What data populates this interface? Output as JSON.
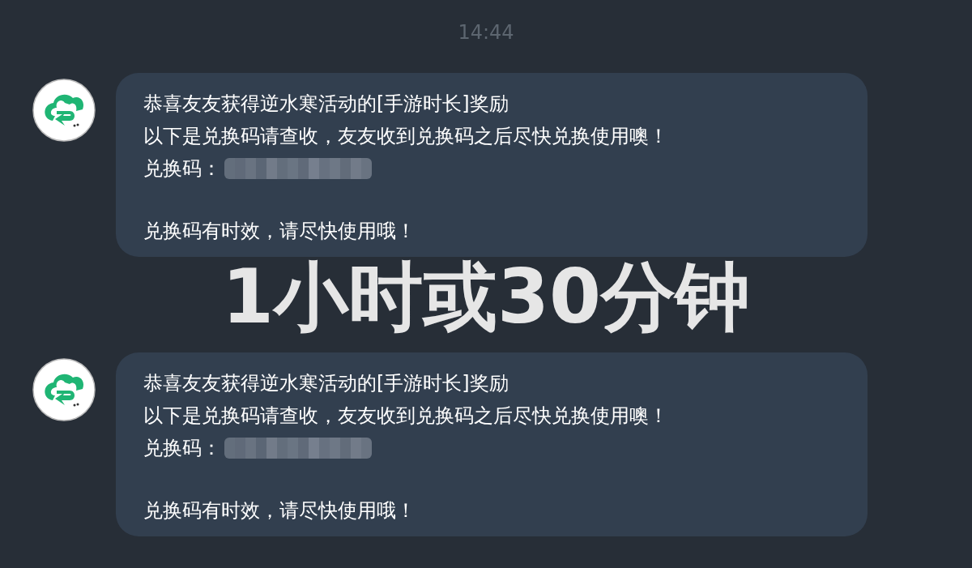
{
  "messages": [
    {
      "time": "14:44",
      "title_line": "恭喜友友获得逆水寒活动的[手游时长]奖励",
      "body_line": "以下是兑换码请查收，友友收到兑换码之后尽快兑换使用噢！",
      "code_label": "兑换码：",
      "note": "兑换码有时效，请尽快使用哦！"
    },
    {
      "title_line": "恭喜友友获得逆水寒活动的[手游时长]奖励",
      "body_line": "以下是兑换码请查收，友友收到兑换码之后尽快兑换使用噢！",
      "code_label": "兑换码：",
      "note": "兑换码有时效，请尽快使用哦！"
    }
  ],
  "overlay_caption": "1小时或30分钟"
}
